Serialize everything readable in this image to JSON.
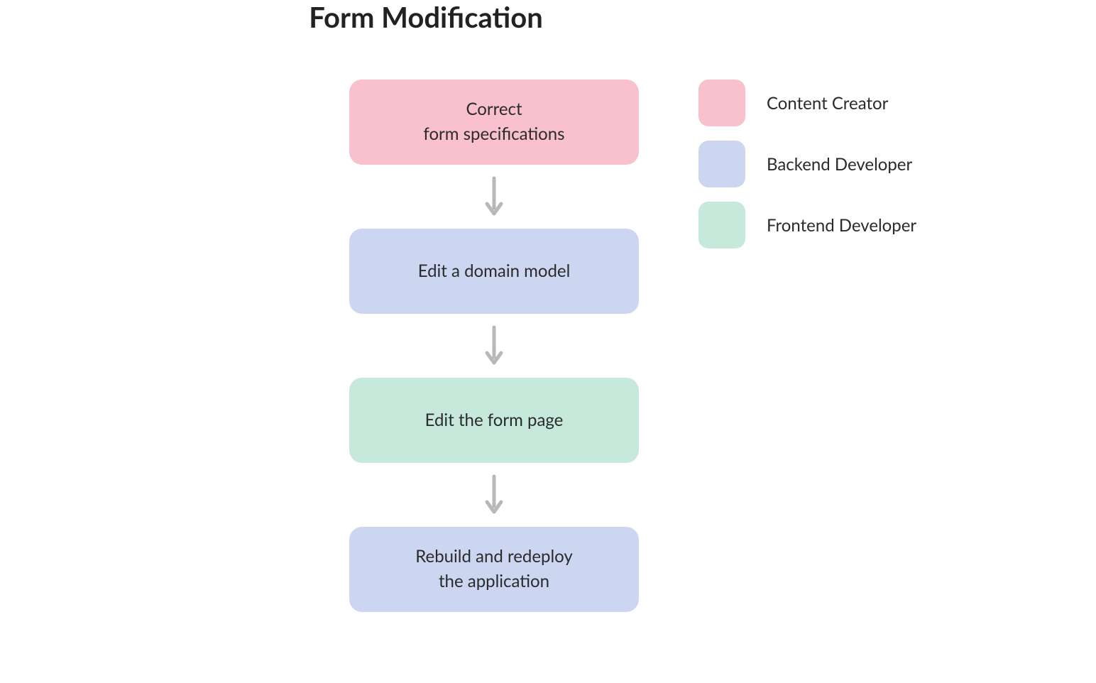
{
  "title": "Form Modification",
  "roles": {
    "content_creator": {
      "label": "Content Creator",
      "color": "#f8c1cd"
    },
    "backend_developer": {
      "label": "Backend Developer",
      "color": "#ccd6f1"
    },
    "frontend_developer": {
      "label": "Frontend Developer",
      "color": "#c6e9dc"
    }
  },
  "steps": [
    {
      "role": "content_creator",
      "line1": "Correct",
      "line2": "form specifications"
    },
    {
      "role": "backend_developer",
      "line1": "Edit a domain model",
      "line2": ""
    },
    {
      "role": "frontend_developer",
      "line1": "Edit the form page",
      "line2": ""
    },
    {
      "role": "backend_developer",
      "line1": "Rebuild and redeploy",
      "line2": "the application"
    }
  ],
  "legend": [
    {
      "role": "content_creator"
    },
    {
      "role": "backend_developer"
    },
    {
      "role": "frontend_developer"
    }
  ],
  "arrow_color": "#b8b8b8"
}
